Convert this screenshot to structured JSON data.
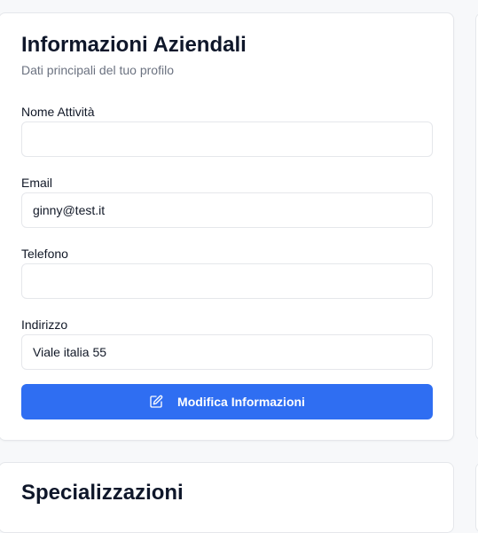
{
  "card": {
    "title": "Informazioni Aziendali",
    "subtitle": "Dati principali del tuo profilo"
  },
  "fields": [
    {
      "label": "Nome Attività",
      "value": "",
      "placeholder": ""
    },
    {
      "label": "Email",
      "value": "ginny@test.it",
      "placeholder": ""
    },
    {
      "label": "Telefono",
      "value": "",
      "placeholder": ""
    },
    {
      "label": "Indirizzo",
      "value": "Viale italia 55",
      "placeholder": ""
    }
  ],
  "button": {
    "label": "Modifica Informazioni",
    "icon": "edit-icon",
    "color": "#2f6ef2"
  },
  "next_card": {
    "title": "Specializzazioni"
  }
}
